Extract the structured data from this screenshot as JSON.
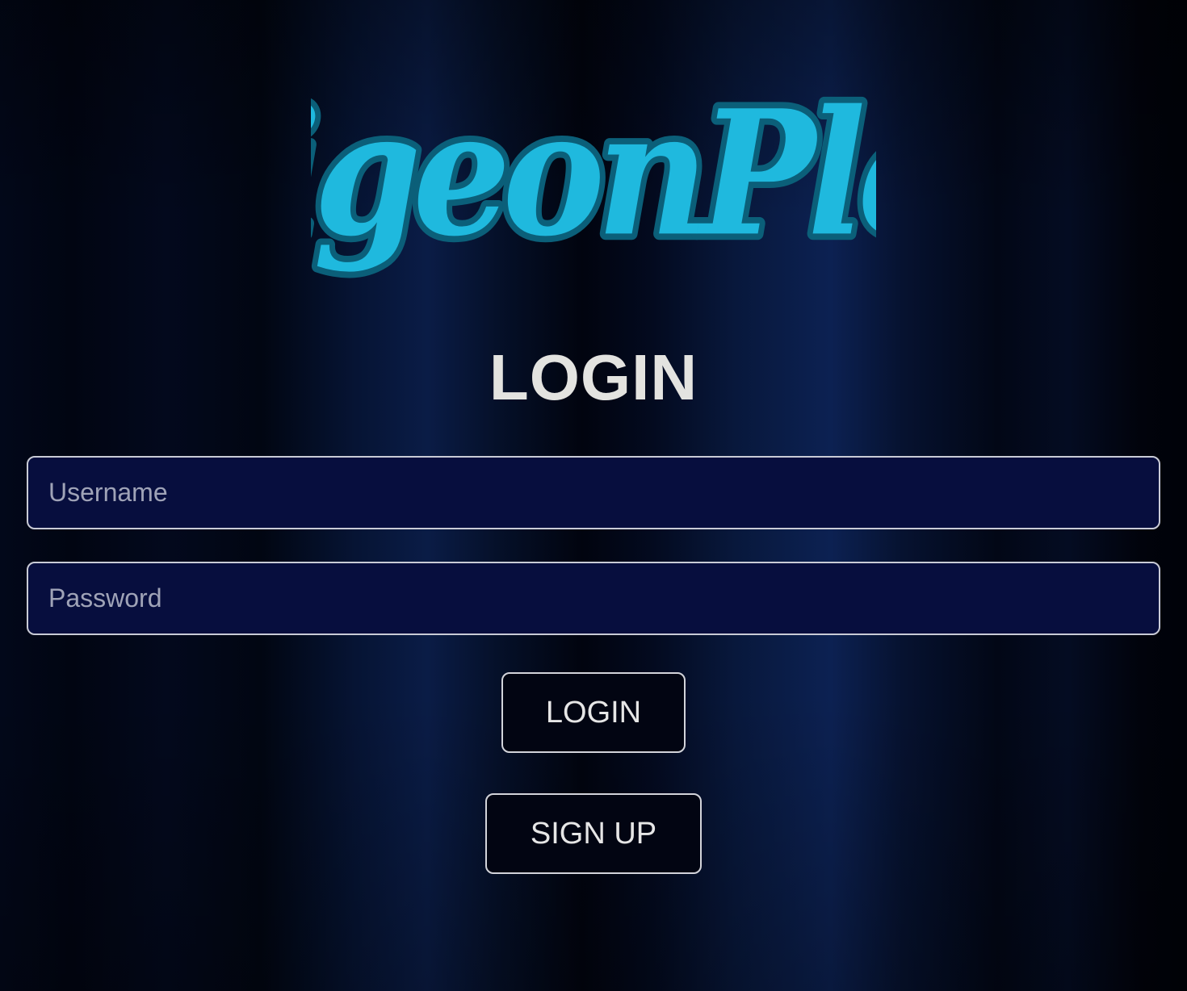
{
  "app": {
    "logo_text": "PigeonPlex"
  },
  "login_form": {
    "heading": "LOGIN",
    "username_placeholder": "Username",
    "password_placeholder": "Password",
    "login_button_label": "LOGIN",
    "signup_button_label": "SIGN UP"
  },
  "colors": {
    "logo_cyan": "#1fb9de",
    "logo_outline": "#0b5f79",
    "input_background": "#070e3e",
    "text_light": "#e3e3e0"
  }
}
